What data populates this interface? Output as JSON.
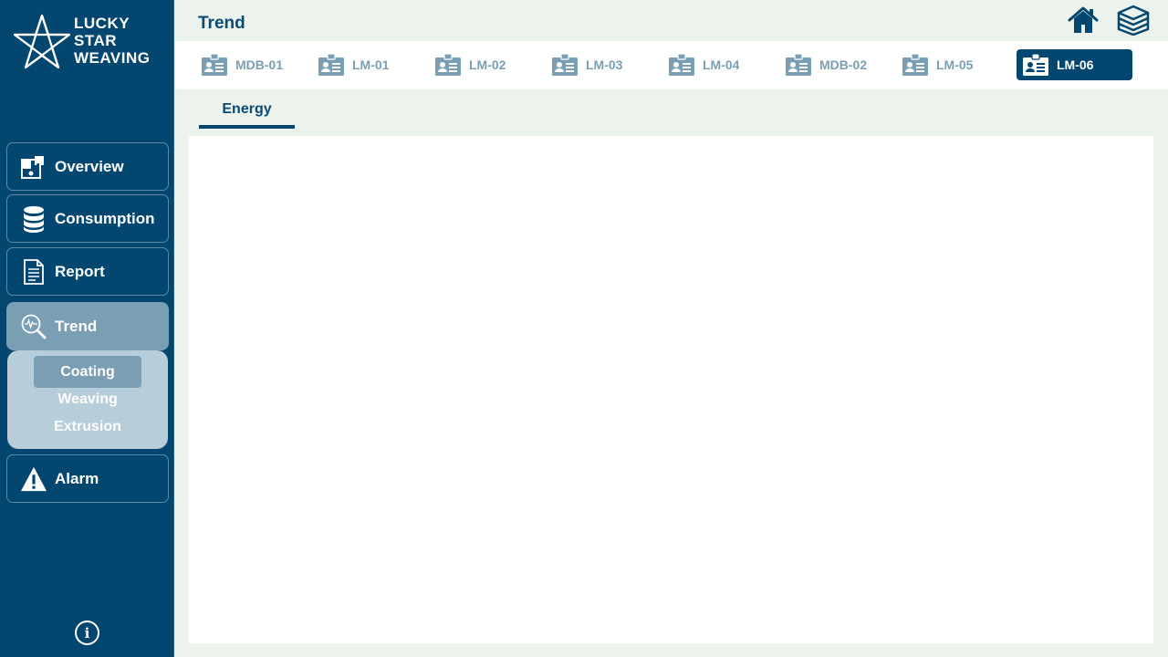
{
  "brand": {
    "line1": "LUCKY",
    "line2": "STAR",
    "line3": "WEAVING",
    "icon": "star-logo-icon"
  },
  "header": {
    "title": "Trend",
    "home_icon": "home-icon",
    "layers_icon": "layers-icon"
  },
  "sidebar": {
    "items": [
      {
        "label": "Overview",
        "icon": "puzzle-icon"
      },
      {
        "label": "Consumption",
        "icon": "database-icon"
      },
      {
        "label": "Report",
        "icon": "document-icon"
      },
      {
        "label": "Trend",
        "icon": "magnifier-pulse-icon",
        "active": true
      },
      {
        "label": "Alarm",
        "icon": "warning-icon"
      }
    ],
    "submenu": [
      {
        "label": "Coating",
        "active": true
      },
      {
        "label": "Weaving"
      },
      {
        "label": "Extrusion"
      }
    ],
    "info_label": "i"
  },
  "device_tabs": [
    {
      "label": "MDB-01"
    },
    {
      "label": "LM-01"
    },
    {
      "label": "LM-02"
    },
    {
      "label": "LM-03"
    },
    {
      "label": "LM-04"
    },
    {
      "label": "MDB-02"
    },
    {
      "label": "LM-05"
    },
    {
      "label": "LM-06",
      "active": true
    }
  ],
  "sub_tab": {
    "label": "Energy"
  },
  "colors": {
    "sidebar": "#03466f",
    "accent_active": "#7a9fb4",
    "submenu_bg": "#b7cdd9",
    "page_bg": "#ebf3ec",
    "title_text": "#0b4a73"
  }
}
